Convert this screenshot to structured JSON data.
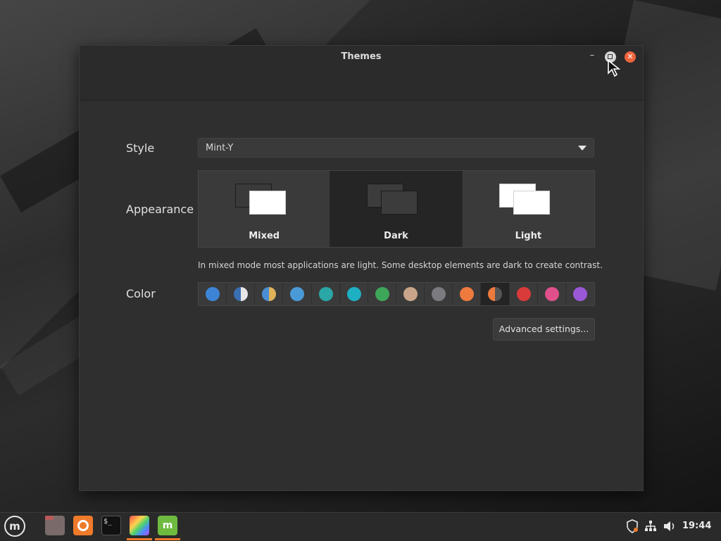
{
  "window": {
    "title": "Themes",
    "minimize_glyph": "–",
    "close_glyph": "✕"
  },
  "style": {
    "label": "Style",
    "value": "Mint-Y"
  },
  "appearance": {
    "label": "Appearance",
    "options": [
      {
        "name": "Mixed",
        "back": "#3a3a3a",
        "front": "#ffffff",
        "selected": false
      },
      {
        "name": "Dark",
        "back": "#3c3c3c",
        "front": "#3c3c3c",
        "selected": true
      },
      {
        "name": "Light",
        "back": "#ffffff",
        "front": "#ffffff",
        "selected": false
      }
    ],
    "hint": "In mixed mode most applications are light. Some desktop elements are dark to create contrast."
  },
  "color": {
    "label": "Color",
    "swatches": [
      {
        "name": "blue",
        "fill": "#3d84d6"
      },
      {
        "name": "aqua-split",
        "fill": "linear-gradient(90deg,#3a6fb2 50%,#e6e6e6 50%)"
      },
      {
        "name": "sand-split",
        "fill": "linear-gradient(90deg,#4a8fd6 50%,#e0b35a 50%)"
      },
      {
        "name": "blue-light",
        "fill": "#4a9ad8"
      },
      {
        "name": "teal",
        "fill": "#2aa6a6"
      },
      {
        "name": "aqua",
        "fill": "#1eb0c2"
      },
      {
        "name": "green",
        "fill": "#3ea659"
      },
      {
        "name": "sand",
        "fill": "#c8a58a"
      },
      {
        "name": "grey",
        "fill": "#7a7a7f"
      },
      {
        "name": "orange",
        "fill": "#ee7a3e"
      },
      {
        "name": "orange-split",
        "fill": "linear-gradient(90deg,#ee7a3e 50%,#555 50%)",
        "selected": true
      },
      {
        "name": "red",
        "fill": "#d93a3a"
      },
      {
        "name": "pink",
        "fill": "#e0508a"
      },
      {
        "name": "purple",
        "fill": "#9a58d6"
      }
    ]
  },
  "advanced_button": "Advanced settings...",
  "taskbar": {
    "menu_glyph": "m",
    "terminal_glyph": "$_",
    "mintinstall_glyph": "m",
    "clock": "19:44",
    "tray": {
      "shield_icon": "shield-icon",
      "network_icon": "network-icon",
      "volume_icon": "volume-icon"
    }
  },
  "colors": {
    "close": "#f0643c",
    "accent": "#ef7a2a",
    "window_bg": "#2f2f2f"
  }
}
